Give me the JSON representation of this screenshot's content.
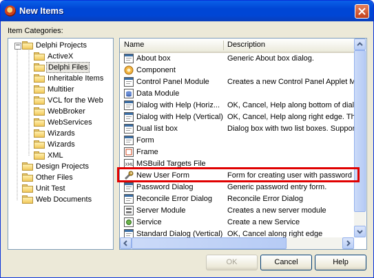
{
  "window": {
    "title": "New Items"
  },
  "categories_label": "Item Categories:",
  "tree": [
    {
      "label": "Delphi Projects",
      "expanded": true
    },
    {
      "label": "ActiveX"
    },
    {
      "label": "Delphi Files",
      "selected": true
    },
    {
      "label": "Inheritable Items"
    },
    {
      "label": "Multitier"
    },
    {
      "label": "VCL for the Web"
    },
    {
      "label": "WebBroker"
    },
    {
      "label": "WebServices"
    },
    {
      "label": "Wizards"
    },
    {
      "label": "Wizards"
    },
    {
      "label": "XML"
    },
    {
      "label": "Design Projects"
    },
    {
      "label": "Other Files"
    },
    {
      "label": "Unit Test"
    },
    {
      "label": "Web Documents"
    }
  ],
  "columns": {
    "name": "Name",
    "description": "Description"
  },
  "items": [
    {
      "name": "About box",
      "description": "Generic About box dialog.",
      "icon": "form-icon"
    },
    {
      "name": "Component",
      "description": "",
      "icon": "component-icon"
    },
    {
      "name": "Control Panel Module",
      "description": "Creates a new Control Panel Applet Mo",
      "icon": "form-icon"
    },
    {
      "name": "Data Module",
      "description": "",
      "icon": "data-module-icon"
    },
    {
      "name": "Dialog with Help (Horiz...",
      "description": "OK, Cancel, Help along bottom of dialo",
      "icon": "form-icon"
    },
    {
      "name": "Dialog with Help (Vertical)",
      "description": "OK, Cancel, Help along right edge. This",
      "icon": "form-icon"
    },
    {
      "name": "Dual list box",
      "description": "Dialog box with two list boxes. Support",
      "icon": "form-icon"
    },
    {
      "name": "Form",
      "description": "",
      "icon": "form-icon"
    },
    {
      "name": "Frame",
      "description": "",
      "icon": "frame-icon"
    },
    {
      "name": "MSBuild Targets File",
      "description": "",
      "icon": "xml-icon"
    },
    {
      "name": "New User Form",
      "description": "Form for creating user with password p",
      "icon": "wrench-icon"
    },
    {
      "name": "Password Dialog",
      "description": "Generic password entry form.",
      "icon": "form-icon"
    },
    {
      "name": "Reconcile Error Dialog",
      "description": "Reconcile Error Dialog",
      "icon": "form-icon"
    },
    {
      "name": "Server Module",
      "description": "Creates a new server module",
      "icon": "server-icon"
    },
    {
      "name": "Service",
      "description": "Create a new Service",
      "icon": "service-icon"
    },
    {
      "name": "Standard Dialog (Vertical)",
      "description": "OK, Cancel along right edge",
      "icon": "form-icon"
    }
  ],
  "buttons": {
    "ok": "OK",
    "cancel": "Cancel",
    "help": "Help"
  },
  "colors": {
    "highlight": "#e00000",
    "title_bar": "#0046d5"
  }
}
